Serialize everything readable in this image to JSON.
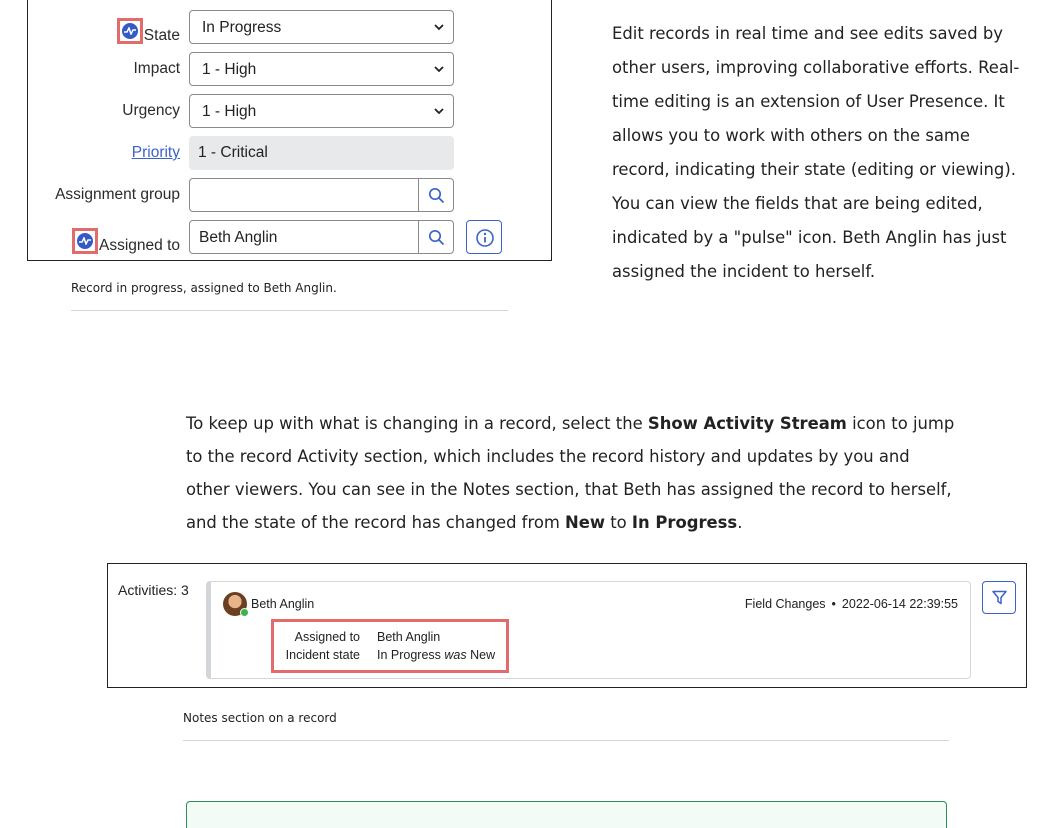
{
  "form": {
    "state": {
      "label": "State",
      "value": "In Progress"
    },
    "impact": {
      "label": "Impact",
      "value": "1 - High"
    },
    "urgency": {
      "label": "Urgency",
      "value": "1 - High"
    },
    "priority": {
      "label": "Priority",
      "value": "1 - Critical"
    },
    "assignment_group": {
      "label": "Assignment group",
      "value": ""
    },
    "assigned_to": {
      "label": "Assigned to",
      "value": "Beth Anglin"
    }
  },
  "caption1": "Record in progress, assigned to Beth Anglin.",
  "para1": {
    "lines": [
      "Edit records in real time and see edits saved by",
      "other users, improving collaborative efforts. Real-",
      "time editing is an extension of User Presence. It",
      "allows you to work with others on the same",
      "record, indicating their state (editing or viewing).",
      "You can view the fields that are being edited,",
      "indicated by a \"pulse\" icon. Beth Anglin has just",
      "assigned the incident to herself."
    ]
  },
  "para2": {
    "line1_pre": "To keep up with what is changing in a record, select the ",
    "line1_bold": "Show Activity Stream",
    "line1_post": " icon to jump",
    "line2": "to the record Activity section, which includes the record history and updates by you and",
    "line3": "other viewers. You can see in the Notes section, that Beth has assigned the record to herself,",
    "line4_pre": "and the state of the record has changed from ",
    "line4_bold1": "New",
    "line4_mid": " to ",
    "line4_bold2": "In Progress",
    "line4_post": "."
  },
  "activity": {
    "title": "Activities: 3",
    "user": "Beth Anglin",
    "type": "Field Changes",
    "timestamp": "2022-06-14 22:39:55",
    "changes": [
      {
        "field": "Assigned to",
        "value": "Beth Anglin",
        "was_label": "",
        "old": ""
      },
      {
        "field": "Incident state",
        "value": "In Progress",
        "was_label": "was",
        "old": "New"
      }
    ]
  },
  "caption2": "Notes section on a record",
  "colors": {
    "highlight": "#e26b6b",
    "presence": "#3559c7",
    "link": "#3b63c8",
    "note_border": "#2e8b57"
  }
}
